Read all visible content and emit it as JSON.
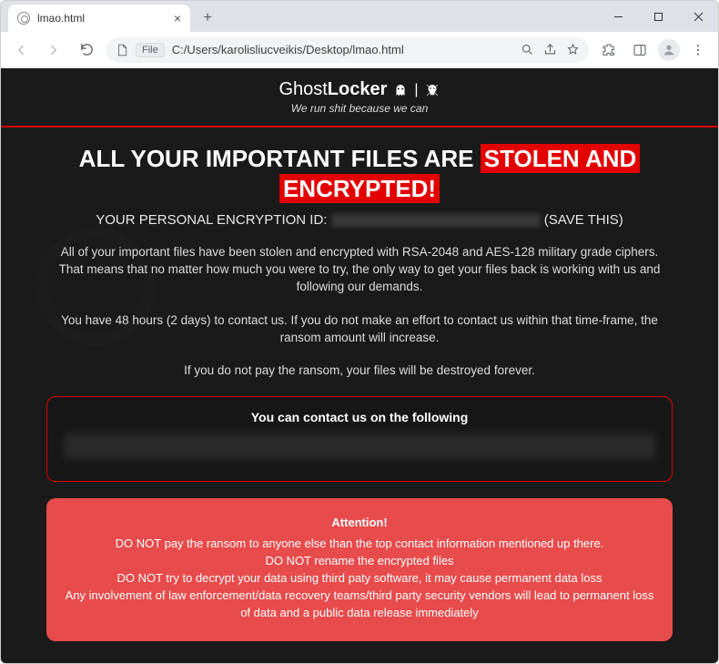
{
  "tab": {
    "title": "lmao.html"
  },
  "addressbar": {
    "file_chip": "File",
    "url": "C:/Users/karolisliucveikis/Desktop/lmao.html"
  },
  "page": {
    "brand_prefix": "Ghost",
    "brand_suffix": "Locker",
    "tagline": "We run shit because we can",
    "headline_pre": "ALL YOUR IMPORTANT FILES ARE ",
    "headline_hl1": "STOLEN AND",
    "headline_hl2": "ENCRYPTED!",
    "pid_label": "YOUR PERSONAL ENCRYPTION ID:",
    "pid_suffix": "(SAVE THIS)",
    "para1": "All of your important files have been stolen and encrypted with RSA-2048 and AES-128 military grade ciphers. That means that no matter how much you were to try, the only way to get your files back is working with us and following our demands.",
    "para2": "You have 48 hours (2 days) to contact us. If you do not make an effort to contact us within that time-frame, the ransom amount will increase.",
    "para3": "If you do not pay the ransom, your files will be destroyed forever.",
    "contact_title": "You can contact us on the following",
    "attention_title": "Attention!",
    "attention_l1": "DO NOT pay the ransom to anyone else than the top contact information mentioned up there.",
    "attention_l2": "DO NOT rename the encrypted files",
    "attention_l3": "DO NOT try to decrypt your data using third paty software, it may cause permanent data loss",
    "attention_l4": "Any involvement of law enforcement/data recovery teams/third party security vendors will lead to permanent loss of data and a public data release immediately"
  }
}
